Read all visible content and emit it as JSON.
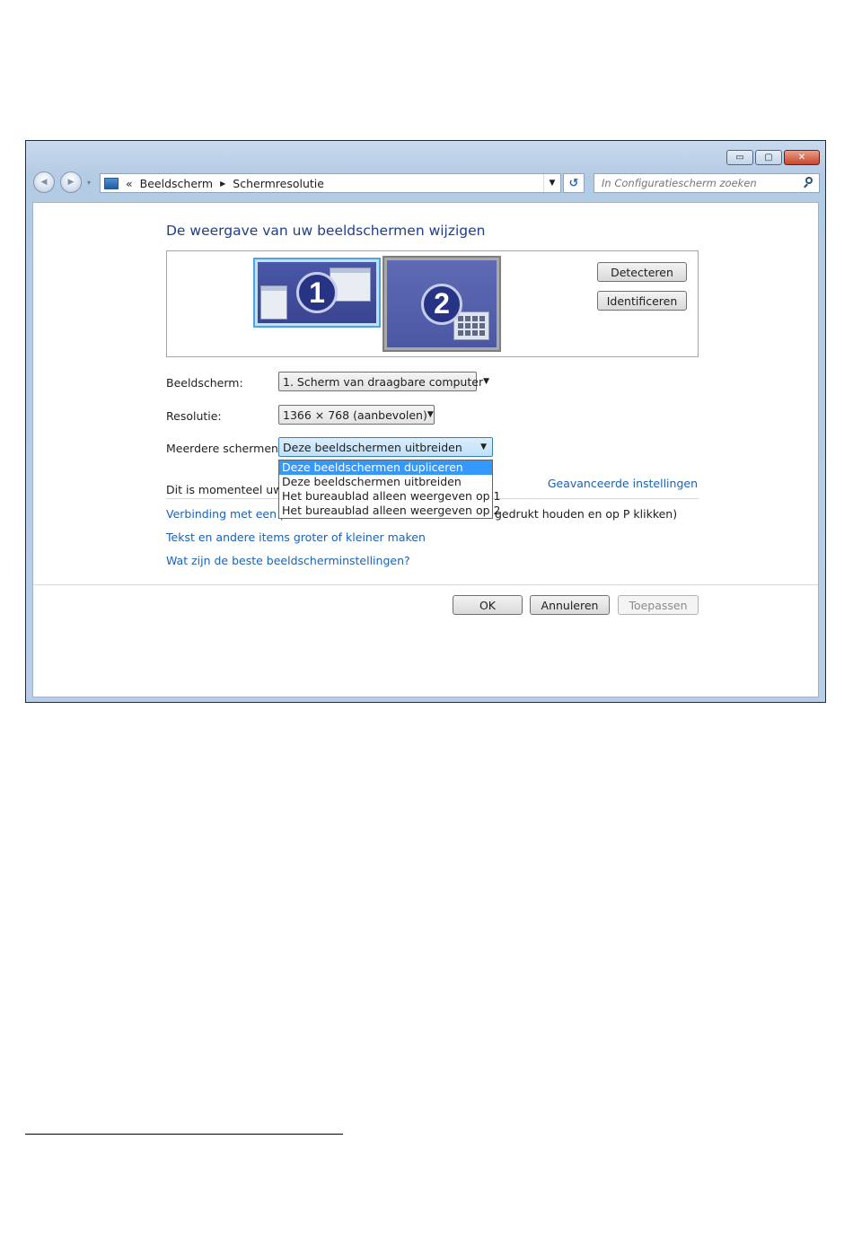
{
  "window": {
    "minimize_glyph": "▭",
    "maximize_glyph": "▢",
    "close_glyph": "✕"
  },
  "nav": {
    "back_glyph": "◀",
    "forward_glyph": "▶",
    "history_glyph": "▾",
    "overflow": "«",
    "breadcrumb": [
      "Beeldscherm",
      "Schermresolutie"
    ],
    "breadcrumb_separator": "▶",
    "address_dropdown_glyph": "▼",
    "refresh_glyph": "↺",
    "search_placeholder": "In Configuratiescherm zoeken"
  },
  "page": {
    "heading": "De weergave van uw beeldschermen wijzigen",
    "monitors": [
      {
        "number": "1",
        "selected": true
      },
      {
        "number": "2",
        "selected": false
      }
    ],
    "detect_button": "Detecteren",
    "identify_button": "Identificeren",
    "display_label": "Beeldscherm:",
    "display_value": "1. Scherm van draagbare computer",
    "resolution_label": "Resolutie:",
    "resolution_value": "1366 × 768 (aanbevolen)",
    "multiple_label": "Meerdere schermen:",
    "multiple_value": "Deze beeldschermen uitbreiden",
    "combo_arrow": "▼",
    "multiple_options": [
      "Deze beeldschermen dupliceren",
      "Deze beeldschermen uitbreiden",
      "Het bureaublad alleen weergeven op 1",
      "Het bureaublad alleen weergeven op 2"
    ],
    "highlighted_option": "Deze beeldschermen dupliceren",
    "status_text": "Dit is momenteel uw h",
    "advanced_link": "Geavanceerde instellingen",
    "projector_link": "Verbinding met een pro",
    "projector_link_rest": "gedrukt houden en op P klikken)",
    "text_size_link": "Tekst en andere items groter of kleiner maken",
    "best_settings_link": "Wat zijn de beste beeldscherminstellingen?",
    "ok_button": "OK",
    "cancel_button": "Annuleren",
    "apply_button": "Toepassen"
  }
}
